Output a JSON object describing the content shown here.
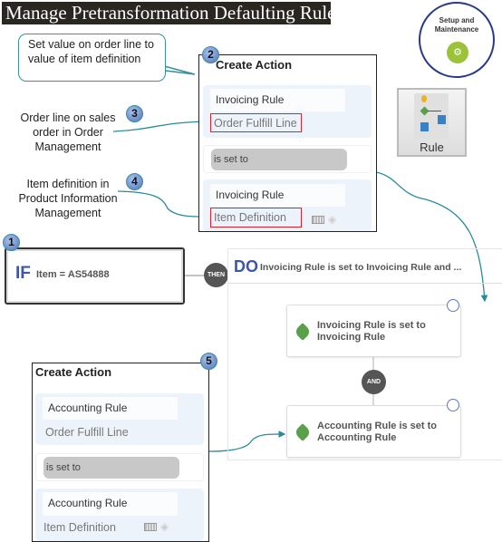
{
  "title": "Manage Pretransformation Defaulting Rules",
  "callouts": {
    "set_value": "Set value  on order line to value of item definition",
    "order_line": "Order line on sales order in Order Management",
    "item_definition": "Item definition in Product Information Management"
  },
  "badges": [
    "1",
    "2",
    "3",
    "4",
    "5"
  ],
  "setup": {
    "label": "Setup and Maintenance",
    "icon": "gears-icon",
    "accent": "#9cc23a",
    "border": "#2a3a8a"
  },
  "rule_tile": {
    "label": "Rule",
    "icon": "rule-flow-icon"
  },
  "create_action_1": {
    "title": "Create Action",
    "attribute": "Invoicing Rule",
    "attribute_source": "Order Fulfill Line",
    "operator": "is set to",
    "value": "Invoicing Rule",
    "value_source": "Item Definition"
  },
  "create_action_2": {
    "title": "Create Action",
    "attribute": "Accounting Rule",
    "attribute_source": "Order Fulfill Line",
    "operator": "is set to",
    "value": "Accounting Rule",
    "value_source": "Item Definition"
  },
  "if_block": {
    "keyword": "IF",
    "condition": "Item = AS54888"
  },
  "then_label": "THEN",
  "do_block": {
    "keyword": "DO",
    "summary": "Invoicing Rule is set to Invoicing Rule and ...",
    "actions": [
      {
        "line1": "Invoicing Rule is set to",
        "line2": "Invoicing Rule"
      },
      {
        "line1": "Accounting Rule is set to",
        "line2": "Accounting Rule"
      }
    ],
    "and_label": "AND"
  },
  "colors": {
    "highlight": "#e0202a",
    "connector": "#2a8a9a",
    "keyword": "#3d56a6"
  }
}
